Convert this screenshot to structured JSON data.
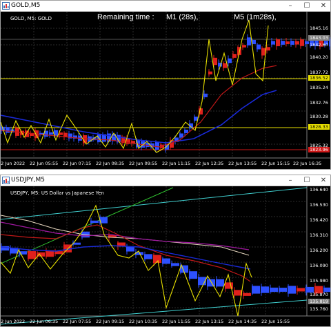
{
  "top": {
    "window_title": "GOLD,M5",
    "symbol_line": "GOLD, M5:  GOLD",
    "remaining_label": "Remaining time :",
    "m1_label": "M1 (28s),",
    "m5_label": "M5 (1m28s),",
    "prices": [
      "1845.16",
      "1842.60",
      "1840.20",
      "1837.72",
      "1836.52",
      "1835.24",
      "1832.76",
      "1830.28",
      "1828.33",
      "1827.80",
      "1825.32"
    ],
    "tags": {
      "upper": "1843.03",
      "yellow": "1836.52",
      "bottom": "1828.33",
      "red": "1823.96"
    },
    "times": [
      "22 Jun 2022",
      "22 Jun 05:55",
      "22 Jun 07:15",
      "22 Jun 08:35",
      "22 Jun 09:55",
      "22 Jun 11:15",
      "22 Jun 12:35",
      "22 Jun 13:55",
      "22 Jun 15:15",
      "22 Jun 16:35"
    ]
  },
  "bottom": {
    "window_title": "USDJPY,M5",
    "symbol_line": "USDJPY, M5:  US Dollar vs Japanese Yen",
    "prices": [
      "136.640",
      "136.530",
      "136.420",
      "136.310",
      "136.200",
      "136.090",
      "135.980",
      "135.870",
      "135.760"
    ],
    "tags": {
      "last": "135.819"
    },
    "times": [
      "22 Jun 2022",
      "22 Jun 06:35",
      "22 Jun 07:55",
      "22 Jun 09:15",
      "22 Jun 10:35",
      "22 Jun 11:55",
      "22 Jun 13:15",
      "22 Jun 14:35",
      "22 Jun 15:55"
    ]
  },
  "colors": {
    "bull": "#e0201c",
    "bear": "#2d50ff",
    "zigzag": "#e8e000",
    "ma_red": "#c01818",
    "ma_blue": "#1a2ad8",
    "ma_purple": "#a018a0",
    "trend_cyan": "#40d0d0",
    "trend_green": "#30c030"
  }
}
